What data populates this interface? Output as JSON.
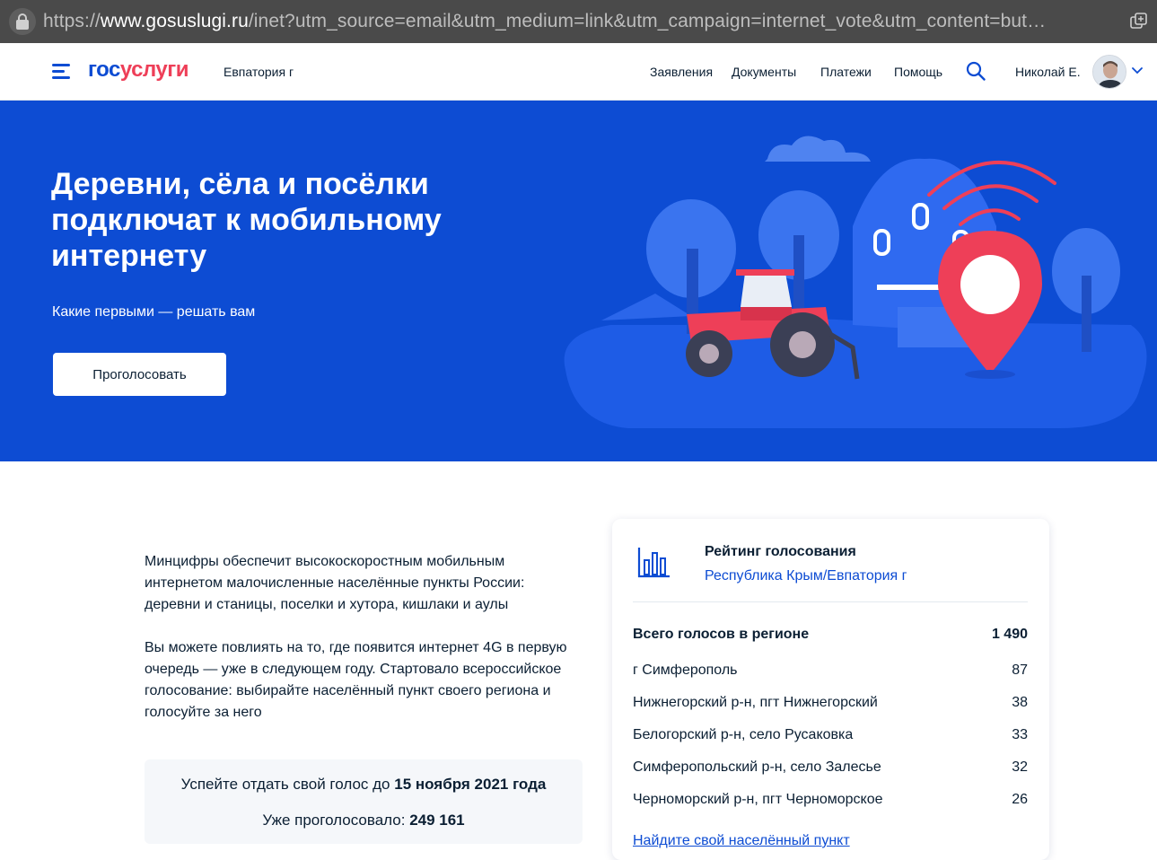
{
  "browser": {
    "url_prefix": "https://",
    "url_host": "www.gosuslugi.ru",
    "url_rest": "/inet?utm_source=email&utm_medium=link&utm_campaign=internet_vote&utm_content=but…"
  },
  "header": {
    "logo_part1": "гос",
    "logo_part2": "услуги",
    "city": "Евпатория г",
    "nav": [
      "Заявления",
      "Документы",
      "Платежи",
      "Помощь"
    ],
    "user_name": "Николай Е."
  },
  "hero": {
    "title": "Деревни, сёла и посёлки подключат к мобильному интернету",
    "subtitle": "Какие первыми — решать вам",
    "button_label": "Проголосовать"
  },
  "intro": {
    "p1": "Минцифры обеспечит высокоскоростным мобильным интернетом малочисленные населённые пункты России: деревни и станицы, поселки и хутора, кишлаки и аулы",
    "p2": "Вы можете повлиять на то, где появится интернет 4G в первую очередь — уже в следующем году. Стартовало всероссийское голосование: выбирайте населённый пункт своего региона и голосуйте за него"
  },
  "deadline": {
    "text": "Успейте отдать свой голос до",
    "date": "15 ноября 2021 года",
    "voted_text": "Уже проголосовало:",
    "voted_count": "249 161"
  },
  "rating": {
    "title": "Рейтинг голосования",
    "region": "Республика Крым/Евпатория г",
    "total_label": "Всего голосов в регионе",
    "total_value": "1 490",
    "rows": [
      {
        "name": "г Симферополь",
        "votes": "87"
      },
      {
        "name": "Нижнегорский р-н, пгт Нижнегорский",
        "votes": "38"
      },
      {
        "name": "Белогорский р-н, село Русаковка",
        "votes": "33"
      },
      {
        "name": "Симферопольский р-н, село Залесье",
        "votes": "32"
      },
      {
        "name": "Черноморский р-н, пгт Черноморское",
        "votes": "26"
      }
    ],
    "find_link": "Найдите свой населённый пункт"
  },
  "colors": {
    "brand_blue": "#0d4cd3",
    "brand_red": "#ee3f58",
    "text": "#0b1f33"
  }
}
